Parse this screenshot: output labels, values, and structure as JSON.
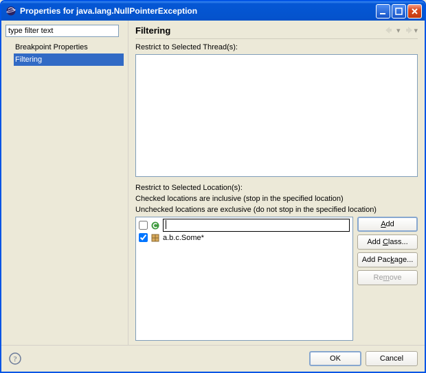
{
  "window": {
    "title": "Properties for java.lang.NullPointerException"
  },
  "sidebar": {
    "filter_placeholder": "type filter text",
    "items": [
      {
        "label": "Breakpoint Properties",
        "selected": false
      },
      {
        "label": "Filtering",
        "selected": true
      }
    ]
  },
  "header": {
    "title": "Filtering"
  },
  "threads": {
    "label": "Restrict to Selected Thread(s):"
  },
  "locations": {
    "label": "Restrict to Selected Location(s):",
    "inclusive_note": "Checked locations are inclusive (stop in the specified location)",
    "exclusive_note": "Unchecked locations are exclusive (do not stop in the specified location)",
    "items": [
      {
        "checked": false,
        "icon": "new-class-icon",
        "editing": true,
        "text": ""
      },
      {
        "checked": true,
        "icon": "package-icon",
        "editing": false,
        "text": "a.b.c.Some*"
      }
    ]
  },
  "side_buttons": {
    "add": "Add",
    "add_class": "Add Class...",
    "add_package": "Add Package...",
    "remove": "Remove"
  },
  "bottom": {
    "ok": "OK",
    "cancel": "Cancel"
  }
}
